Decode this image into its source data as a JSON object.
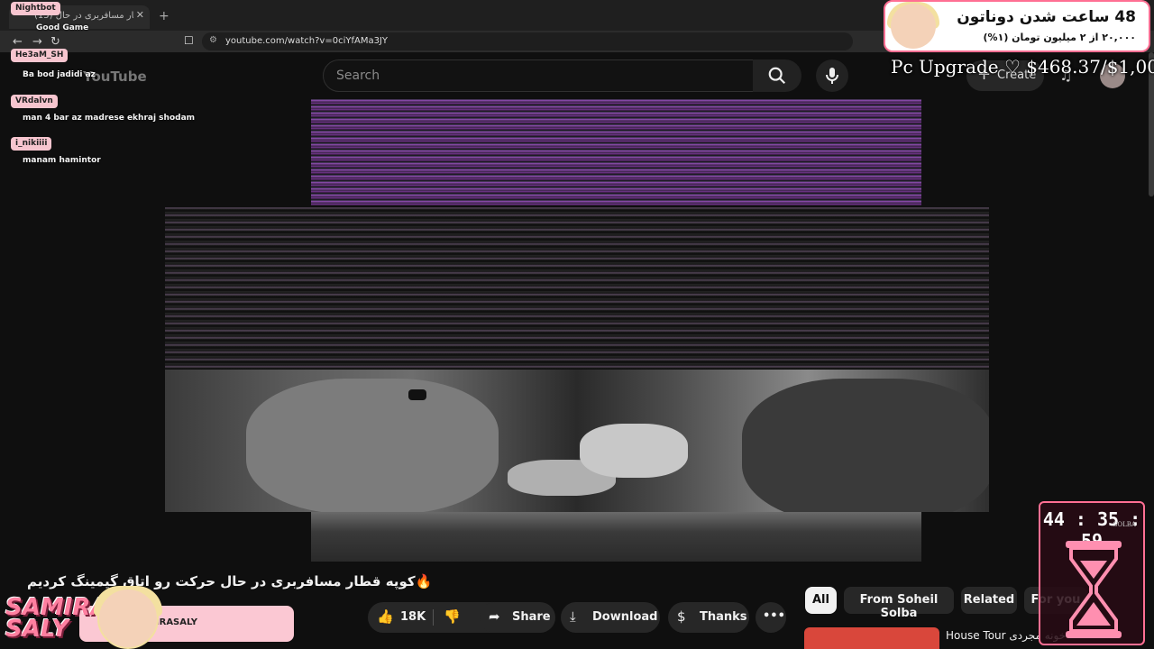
{
  "browser": {
    "tab_title": "(15) کوپه قطار مسافربری در حال",
    "tab_close": "✕",
    "new_tab": "+",
    "url": "youtube.com/watch?v=0ciYfAMa3JY"
  },
  "youtube": {
    "logo": "YouTube",
    "search_placeholder": "Search",
    "create_label": "Create",
    "video_title": "🔥کوپه قطار مسافربری در حال حرکت رو اتاق گیمینگ کردیم",
    "actions": {
      "likes": "18K",
      "share": "Share",
      "download": "Download",
      "thanks": "Thanks",
      "more": "•••"
    },
    "chips": [
      "All",
      "From Soheil Solba",
      "Related",
      "For you"
    ],
    "recommended_title": "House Tour خونه مجردی"
  },
  "chat": [
    {
      "name": "Nightbot",
      "message": "Good Game"
    },
    {
      "name": "He3aM_SH",
      "message": "Ba bod jadidi az"
    },
    {
      "name": "VRdalvn",
      "message": "man 4 bar az madrese ekhraj shodam"
    },
    {
      "name": "i_nikiiii",
      "message": "manam hamintor"
    }
  ],
  "overlay": {
    "donation_title": "48 ساعت شدن دوناتون",
    "donation_sub": "۲۰,۰۰۰ از ۲ میلیون تومان (۱%)",
    "goal": "Pc Upgrade ♡ $468.37/$1,000",
    "timer": "44 : 35 : 59",
    "timer_brand": "SOLBA",
    "streamer_logo_line1": "SAMIRA",
    "streamer_logo_line2": "SALY",
    "streamer_handle": "SAMIRASALY"
  },
  "colors": {
    "accent_pink": "#ff6f93",
    "chip_active": "#f1f1f1",
    "background": "#0f0f0f"
  }
}
